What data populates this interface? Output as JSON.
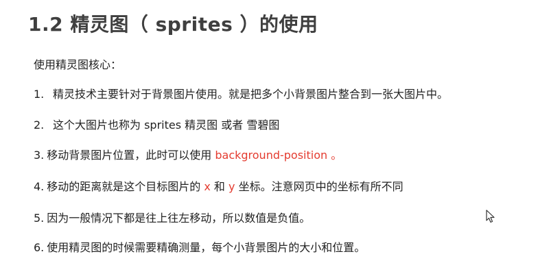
{
  "title": "1.2 精灵图（ sprites ）的使用",
  "intro": "使用精灵图核心：",
  "items": [
    {
      "num": "1.",
      "text": "精灵技术主要针对于背景图片使用。就是把多个小背景图片整合到一张大图片中。"
    },
    {
      "num": "2.",
      "text": "这个大图片也称为 sprites  精灵图  或者 雪碧图"
    },
    {
      "num": "3.",
      "pre": "移动背景图片位置，此时可以使用 ",
      "highlight": "background-position",
      "post": " 。"
    },
    {
      "num": "4.",
      "pre": "移动的距离就是这个目标图片的 ",
      "x": "x",
      "mid": " 和 ",
      "y": "y",
      "post": " 坐标。注意网页中的坐标有所不同"
    },
    {
      "num": "5.",
      "text": "因为一般情况下都是往上往左移动，所以数值是负值。"
    },
    {
      "num": "6.",
      "text": "使用精灵图的时候需要精确测量，每个小背景图片的大小和位置。"
    }
  ],
  "colors": {
    "title": "#3f3f3f",
    "text": "#222222",
    "highlight": "#e43b2f"
  },
  "cursor_icon": "mouse-pointer-icon"
}
